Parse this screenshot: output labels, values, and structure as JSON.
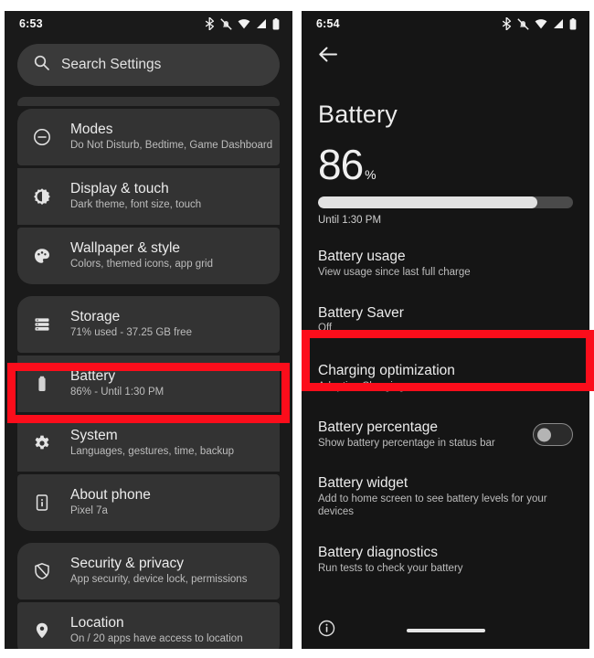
{
  "accent_red": "#fc0d1b",
  "left_screen": {
    "status_bar": {
      "time": "6:53",
      "icons": [
        "bluetooth-icon",
        "ringer-muted-icon",
        "wifi-icon",
        "cellular-signal-icon",
        "battery-icon"
      ]
    },
    "search": {
      "placeholder": "Search Settings",
      "icon": "search-icon"
    },
    "groups": [
      {
        "items": [
          {
            "icon": "do-not-disturb-icon",
            "title": "Modes",
            "subtitle": "Do Not Disturb, Bedtime, Game Dashboard"
          },
          {
            "icon": "display-brightness-icon",
            "title": "Display & touch",
            "subtitle": "Dark theme, font size, touch"
          },
          {
            "icon": "palette-icon",
            "title": "Wallpaper & style",
            "subtitle": "Colors, themed icons, app grid"
          }
        ]
      },
      {
        "items": [
          {
            "icon": "storage-icon",
            "title": "Storage",
            "subtitle": "71% used - 37.25 GB free"
          },
          {
            "icon": "battery-icon",
            "title": "Battery",
            "subtitle": "86% - Until 1:30 PM",
            "highlighted": true
          },
          {
            "icon": "gear-icon",
            "title": "System",
            "subtitle": "Languages, gestures, time, backup"
          },
          {
            "icon": "phone-info-icon",
            "title": "About phone",
            "subtitle": "Pixel 7a"
          }
        ]
      },
      {
        "items": [
          {
            "icon": "shield-icon",
            "title": "Security & privacy",
            "subtitle": "App security, device lock, permissions"
          },
          {
            "icon": "location-pin-icon",
            "title": "Location",
            "subtitle": "On / 20 apps have access to location"
          }
        ]
      }
    ]
  },
  "right_screen": {
    "status_bar": {
      "time": "6:54",
      "icons": [
        "bluetooth-icon",
        "ringer-muted-icon",
        "wifi-icon",
        "cellular-signal-icon",
        "battery-icon"
      ]
    },
    "back_icon": "back-arrow-icon",
    "title": "Battery",
    "level": {
      "percent_value": "86",
      "percent_symbol": "%",
      "fill_percent": 86,
      "caption": "Until 1:30 PM"
    },
    "items": [
      {
        "title": "Battery usage",
        "subtitle": "View usage since last full charge"
      },
      {
        "title": "Battery Saver",
        "subtitle": "Off",
        "highlighted": true
      },
      {
        "title": "Charging optimization",
        "subtitle": "Adaptive Charging"
      },
      {
        "title": "Battery percentage",
        "subtitle": "Show battery percentage in status bar",
        "toggle": "off"
      },
      {
        "title": "Battery widget",
        "subtitle": "Add to home screen to see battery levels for your devices"
      },
      {
        "title": "Battery diagnostics",
        "subtitle": "Run tests to check your battery"
      }
    ],
    "bottom_bar": {
      "icon": "info-icon",
      "home_indicator": "home-pill"
    }
  }
}
